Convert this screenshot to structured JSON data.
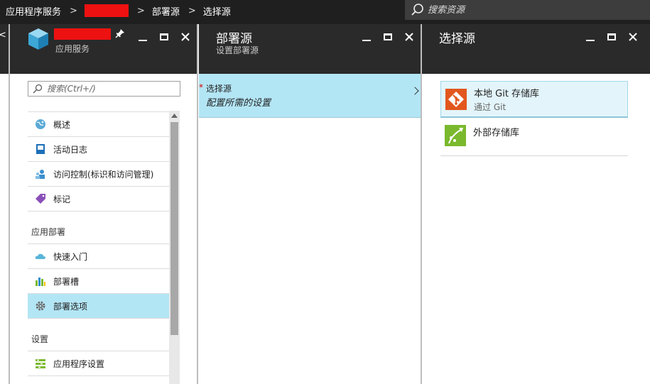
{
  "topbar": {
    "crumbs": [
      "应用程序服务",
      "部署源",
      "选择源"
    ],
    "search_placeholder": "搜索资源"
  },
  "blade_app": {
    "subtitle": "应用服务",
    "search_placeholder": "搜索(Ctrl+/)",
    "items_top": [
      "概述",
      "活动日志",
      "访问控制(标识和访问管理)",
      "标记"
    ],
    "section_deploy": "应用部署",
    "items_deploy": [
      "快速入门",
      "部署槽",
      "部署选项"
    ],
    "section_settings": "设置",
    "items_settings": [
      "应用程序设置"
    ]
  },
  "blade_deploy_source": {
    "title": "部署源",
    "subtitle": "设置部署源",
    "field_label": "选择源",
    "field_value": "配置所需的设置"
  },
  "blade_choose_source": {
    "title": "选择源",
    "options": [
      {
        "title": "本地 Git 存储库",
        "subtitle": "通过 Git"
      },
      {
        "title": "外部存储库"
      }
    ]
  },
  "colors": {
    "topbar_bg": "#1f1f1f",
    "blade_header_bg": "#2a2a2a",
    "selection_bg": "#b3e6f5",
    "git_orange": "#e2571e",
    "external_green": "#7ab92d"
  }
}
